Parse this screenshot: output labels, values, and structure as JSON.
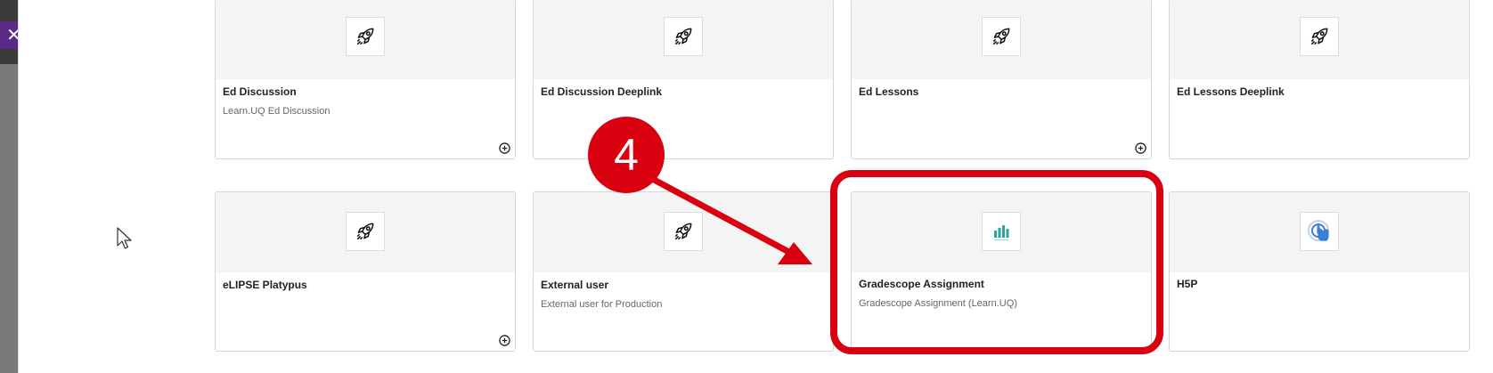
{
  "window": {
    "close_label": "✕"
  },
  "cards": [
    {
      "title": "Ed Discussion",
      "description": "Learn.UQ Ed Discussion",
      "icon": "rocket-icon",
      "has_add": true
    },
    {
      "title": "Ed Discussion Deeplink",
      "description": "",
      "icon": "rocket-icon",
      "has_add": false
    },
    {
      "title": "Ed Lessons",
      "description": "",
      "icon": "rocket-icon",
      "has_add": true
    },
    {
      "title": "Ed Lessons Deeplink",
      "description": "",
      "icon": "rocket-icon",
      "has_add": false
    },
    {
      "title": "eLIPSE Platypus",
      "description": "",
      "icon": "rocket-icon",
      "has_add": true
    },
    {
      "title": "External user",
      "description": "External user for Production",
      "icon": "rocket-icon",
      "has_add": false
    },
    {
      "title": "Gradescope Assignment",
      "description": "Gradescope Assignment (Learn.UQ)",
      "icon": "gradescope-icon",
      "has_add": false
    },
    {
      "title": "H5P",
      "description": "",
      "icon": "h5p-icon",
      "has_add": false
    }
  ],
  "annotation": {
    "step_number": "4",
    "color": "#d9000f"
  },
  "colors": {
    "close_bg": "#5b2a86",
    "card_top_bg": "#f4f4f4",
    "gradescope_teal": "#2aa7a3",
    "h5p_blue": "#3b7dd8"
  }
}
